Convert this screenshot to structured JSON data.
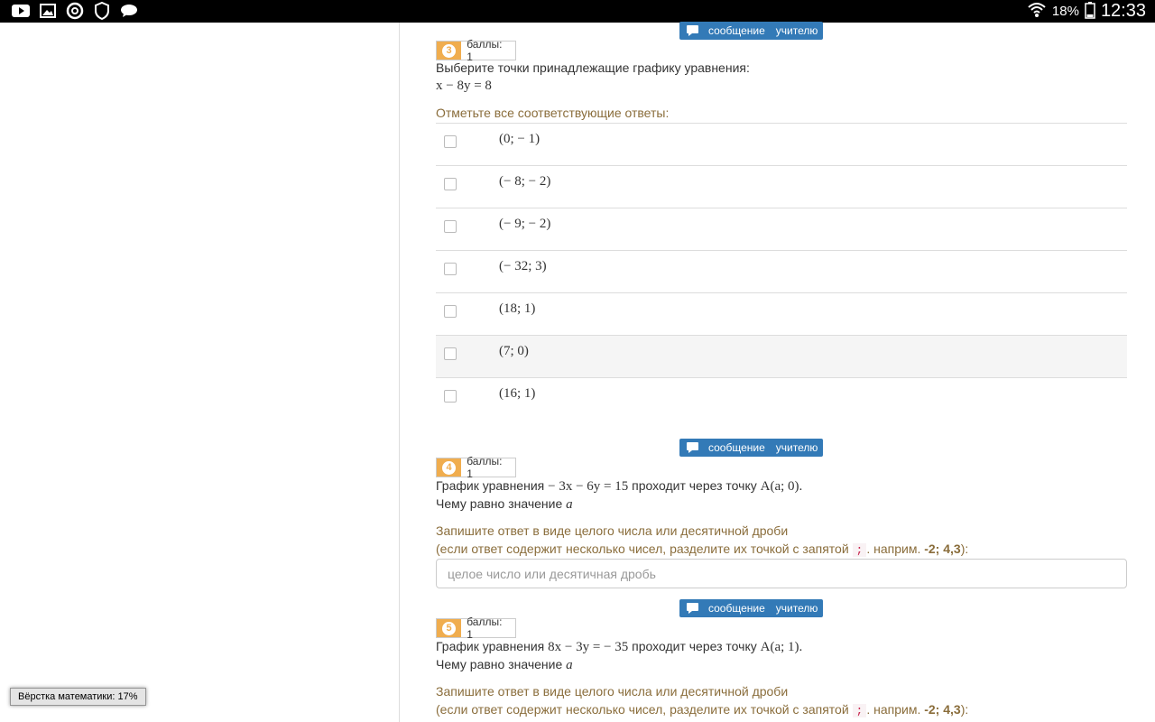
{
  "statusbar": {
    "battery": "18%",
    "time": "12:33"
  },
  "message_button": {
    "word1": "сообщение",
    "word2": "учителю"
  },
  "questions": [
    {
      "number": "3",
      "points": "баллы: 1",
      "text_line1": "Выберите точки принадлежащие графику уравнения:",
      "equation": "x − 8y = 8",
      "hint": "Отметьте все соответствующие ответы:",
      "options": [
        "(0;  − 1)",
        "(− 8;  − 2)",
        "(− 9;  − 2)",
        "(− 32; 3)",
        "(18; 1)",
        "(7; 0)",
        "(16; 1)"
      ]
    },
    {
      "number": "4",
      "points": "баллы: 1",
      "text_pre": "График уравнения ",
      "equation": "− 3x − 6y = 15",
      "text_mid": " проходит через точку ",
      "point": "A(a; 0).",
      "text_line2": "Чему равно значение ",
      "var": "a",
      "hint_line1": "Запишите ответ в виде целого числа или десятичной дроби",
      "hint_line2_pre": "(если ответ содержит несколько чисел, разделите их точкой с запятой ",
      "hint_code": ";",
      "hint_line2_mid": ". наприм. ",
      "hint_example": "-2; 4,3",
      "hint_line2_post": "):",
      "placeholder": "целое число или десятичная дробь"
    },
    {
      "number": "5",
      "points": "баллы: 1",
      "text_pre": "График уравнения ",
      "equation": "8x − 3y =  − 35",
      "text_mid": " проходит через точку ",
      "point": "A(a; 1).",
      "text_line2": "Чему равно значение ",
      "var": "a",
      "hint_line1": "Запишите ответ в виде целого числа или десятичной дроби",
      "hint_line2_pre": "(если ответ содержит несколько чисел, разделите их точкой с запятой ",
      "hint_code": ";",
      "hint_line2_mid": ". наприм. ",
      "hint_example": "-2; 4,3",
      "hint_line2_post": "):"
    }
  ],
  "mathjax_status": "Вёрстка математики: 17%"
}
